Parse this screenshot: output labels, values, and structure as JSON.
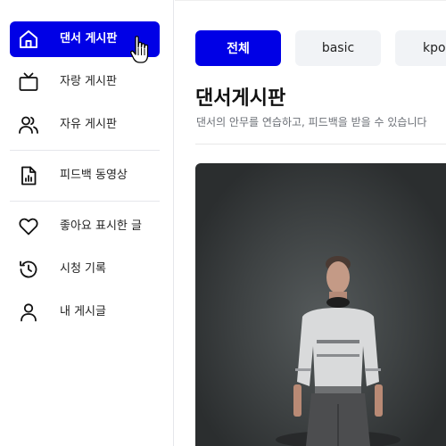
{
  "sidebar": {
    "items": [
      {
        "label": "댄서 게시판",
        "icon": "home-icon",
        "active": true
      },
      {
        "label": "자랑 게시판",
        "icon": "tv-icon",
        "active": false
      },
      {
        "label": "자유 게시판",
        "icon": "users-icon",
        "active": false
      },
      {
        "label": "피드백 동영상",
        "icon": "chart-file-icon",
        "active": false
      },
      {
        "label": "좋아요 표시한 글",
        "icon": "heart-icon",
        "active": false
      },
      {
        "label": "시청 기록",
        "icon": "history-icon",
        "active": false
      },
      {
        "label": "내 게시글",
        "icon": "user-icon",
        "active": false
      }
    ]
  },
  "filters": {
    "chips": [
      {
        "label": "전체",
        "active": true
      },
      {
        "label": "basic",
        "active": false
      },
      {
        "label": "kpop",
        "active": false
      }
    ]
  },
  "main": {
    "title": "댄서게시판",
    "description": "댄서의 안무를 연습하고, 피드백을 받을 수 있습니다"
  },
  "colors": {
    "accent": "#0000e6",
    "chip_bg": "#f1f3f6",
    "muted_text": "#6b6f76"
  }
}
